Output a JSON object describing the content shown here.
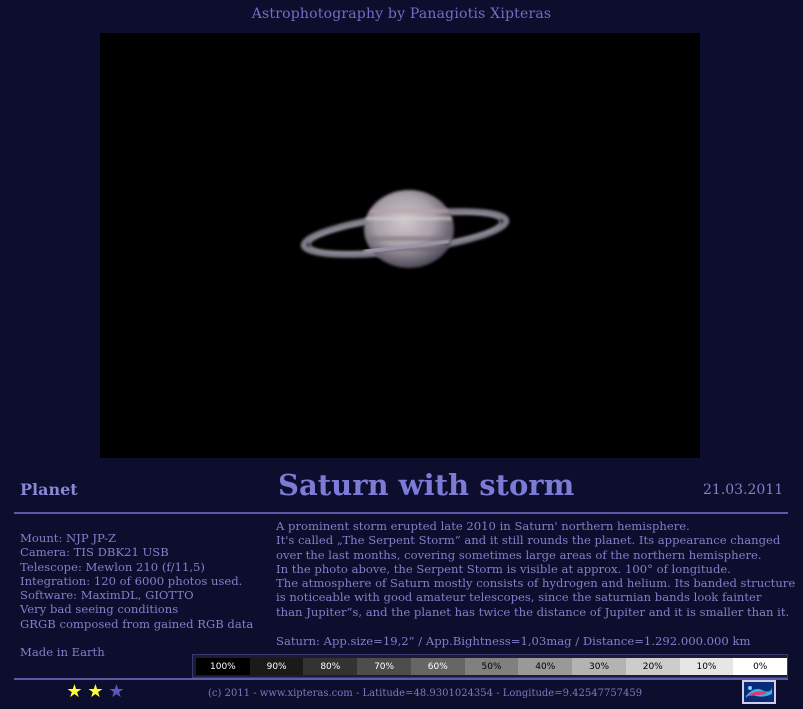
{
  "header": {
    "site_title": "Astrophotography by Panagiotis Xipteras"
  },
  "title_bar": {
    "category": "Planet",
    "title": "Saturn with storm",
    "date": "21.03.2011"
  },
  "specs": [
    "Mount: NJP JP-Z",
    "Camera: TIS DBK21 USB",
    "Telescope: Mewlon 210 (f/11,5)",
    "Integration: 120 of 6000 photos used.",
    "Software: MaximDL, GIOTTO",
    "Very bad seeing conditions",
    "GRGB composed from gained RGB data"
  ],
  "origin": "Made in Earth",
  "description": [
    "A prominent storm erupted late 2010 in Saturn' northern hemisphere.",
    "It's called „The Serpent Storm“ and it still rounds the planet. Its appearance changed",
    "over the last months, covering sometimes large areas of the northern hemisphere.",
    "In the photo above, the Serpent Storm is visible  at approx. 100° of longitude.",
    "The atmosphere of Saturn mostly consists of  hydrogen and helium. Its banded structure",
    "is noticeable with good amateur telescopes, since the saturnian bands look fainter",
    "than Jupiter“s, and the planet has twice the distance of Jupiter and it is smaller than it."
  ],
  "stats": "Saturn: App.size=19,2“ / App.Bightness=1,03mag / Distance=1.292.000.000 km",
  "brightness_scale": [
    {
      "label": "100%",
      "bg": "#000000",
      "fg": "#ffffff"
    },
    {
      "label": "90%",
      "bg": "#1a1a1a",
      "fg": "#ffffff"
    },
    {
      "label": "80%",
      "bg": "#333333",
      "fg": "#ffffff"
    },
    {
      "label": "70%",
      "bg": "#4d4d4d",
      "fg": "#ffffff"
    },
    {
      "label": "60%",
      "bg": "#666666",
      "fg": "#ffffff"
    },
    {
      "label": "50%",
      "bg": "#808080",
      "fg": "#000000"
    },
    {
      "label": "40%",
      "bg": "#999999",
      "fg": "#000000"
    },
    {
      "label": "30%",
      "bg": "#b3b3b3",
      "fg": "#000000"
    },
    {
      "label": "20%",
      "bg": "#cccccc",
      "fg": "#000000"
    },
    {
      "label": "10%",
      "bg": "#e6e6e6",
      "fg": "#000000"
    },
    {
      "label": "0%",
      "bg": "#ffffff",
      "fg": "#000000"
    }
  ],
  "rating": {
    "stars": 2,
    "max": 3,
    "filled_color": "#ffff33",
    "empty_color": "#5858c0"
  },
  "footer": "(c) 2011 - www.xipteras.com - Latitude=48.9301024354 - Longitude=9.42547757459",
  "colors": {
    "background": "#0d0d2e",
    "text": "#8080c8",
    "rule": "#5a5aa8"
  }
}
